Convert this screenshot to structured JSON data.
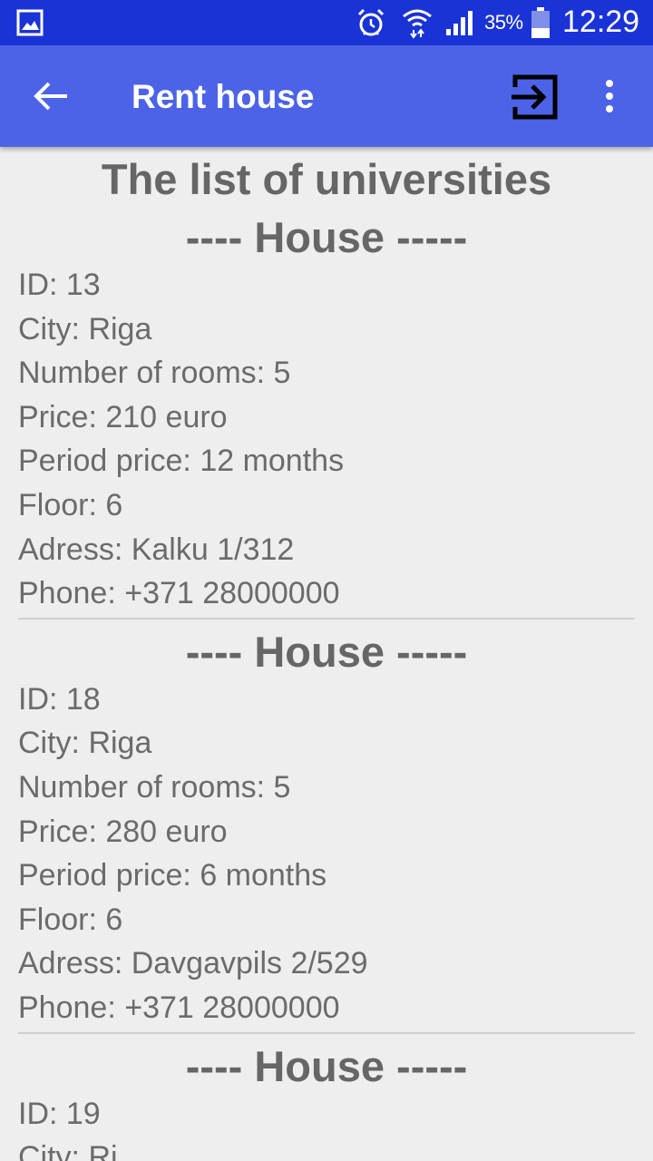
{
  "status_bar": {
    "battery_percent": "35%",
    "time": "12:29",
    "icons": [
      "gallery-icon",
      "alarm-icon",
      "wifi-icon",
      "signal-icon",
      "battery-icon"
    ]
  },
  "app_bar": {
    "title": "Rent house",
    "icons": [
      "back-arrow-icon",
      "exit-icon",
      "more-vert-icon"
    ]
  },
  "page": {
    "heading": "The list of universities"
  },
  "houses": [
    {
      "heading": "---- House -----",
      "id": "ID: 13",
      "city": "City: Riga",
      "rooms": "Number of rooms: 5",
      "price": "Price: 210 euro",
      "period": "Period price: 12 months",
      "floor": "Floor: 6",
      "address": "Adress: Kalku 1/312",
      "phone": "Phone: +371 28000000"
    },
    {
      "heading": "---- House -----",
      "id": "ID: 18",
      "city": "City: Riga",
      "rooms": "Number of rooms: 5",
      "price": "Price: 280 euro",
      "period": "Period price: 6 months",
      "floor": "Floor: 6",
      "address": "Adress: Davgavpils 2/529",
      "phone": "Phone: +371 28000000"
    },
    {
      "heading": "---- House -----",
      "id": "ID: 19",
      "city": "City: Ri"
    }
  ],
  "colors": {
    "status_bar": "#1a33d6",
    "app_bar": "#4c63e8",
    "background": "#eeeeee",
    "text": "#6b6b6b",
    "heading": "#666666"
  }
}
